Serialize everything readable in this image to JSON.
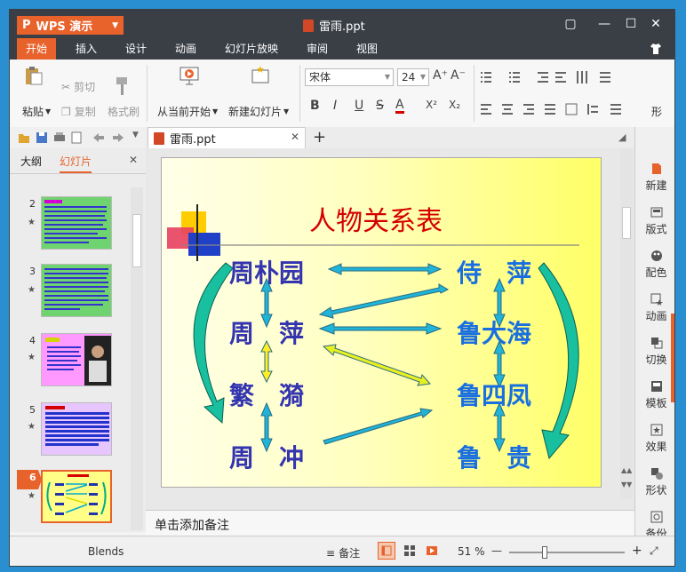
{
  "app": {
    "name": "WPS 演示",
    "logo": "P",
    "doc_title": "雷雨.ppt"
  },
  "window_controls": {
    "skin": "shirt-icon",
    "restore": "▢",
    "minimize": "—",
    "maximize": "☐",
    "close": "✕"
  },
  "menu": [
    "开始",
    "插入",
    "设计",
    "动画",
    "幻灯片放映",
    "审阅",
    "视图"
  ],
  "ribbon": {
    "paste": "粘贴",
    "cut": "剪切",
    "copy": "复制",
    "format_painter": "格式刷",
    "from_current": "从当前开始",
    "new_slide": "新建幻灯片",
    "font_name": "宋体",
    "font_size": "24",
    "bold": "B",
    "italic": "I",
    "underline": "U",
    "strike": "S",
    "fontcolor": "A",
    "sup": "X²",
    "sub": "X₂",
    "grow": "A⁺",
    "shrink": "A⁻",
    "shape_label": "形"
  },
  "left_panel": {
    "tab_outline": "大纲",
    "tab_slides": "幻灯片",
    "close": "✕",
    "thumbs": [
      {
        "num": "2",
        "star": "★"
      },
      {
        "num": "3",
        "star": "★"
      },
      {
        "num": "4",
        "star": "★"
      },
      {
        "num": "5",
        "star": "★"
      },
      {
        "num": "6",
        "star": "★"
      }
    ]
  },
  "doc_tab": {
    "label": "雷雨.ppt",
    "close": "✕",
    "add": "+"
  },
  "slide": {
    "title": "人物关系表",
    "left_names": [
      "周朴园",
      "周　萍",
      "繁　漪",
      "周　冲"
    ],
    "right_names": [
      "侍　萍",
      "鲁大海",
      "鲁四凤",
      "鲁　贵"
    ]
  },
  "notes_placeholder": "单击添加备注",
  "right_bar": [
    "新建",
    "版式",
    "配色",
    "动画",
    "切换",
    "模板",
    "效果",
    "形状",
    "备份"
  ],
  "status": {
    "theme": "Blends",
    "notes": "备注",
    "zoom": "51 %",
    "zoom_minus": "—",
    "zoom_plus": "+",
    "zoom_percent": 51
  },
  "colors": {
    "accent": "#e8622c",
    "titlebar": "#3a3f46",
    "slide_title": "#d40000",
    "left_names": "#3434b0",
    "right_names": "#1a6fe0"
  }
}
